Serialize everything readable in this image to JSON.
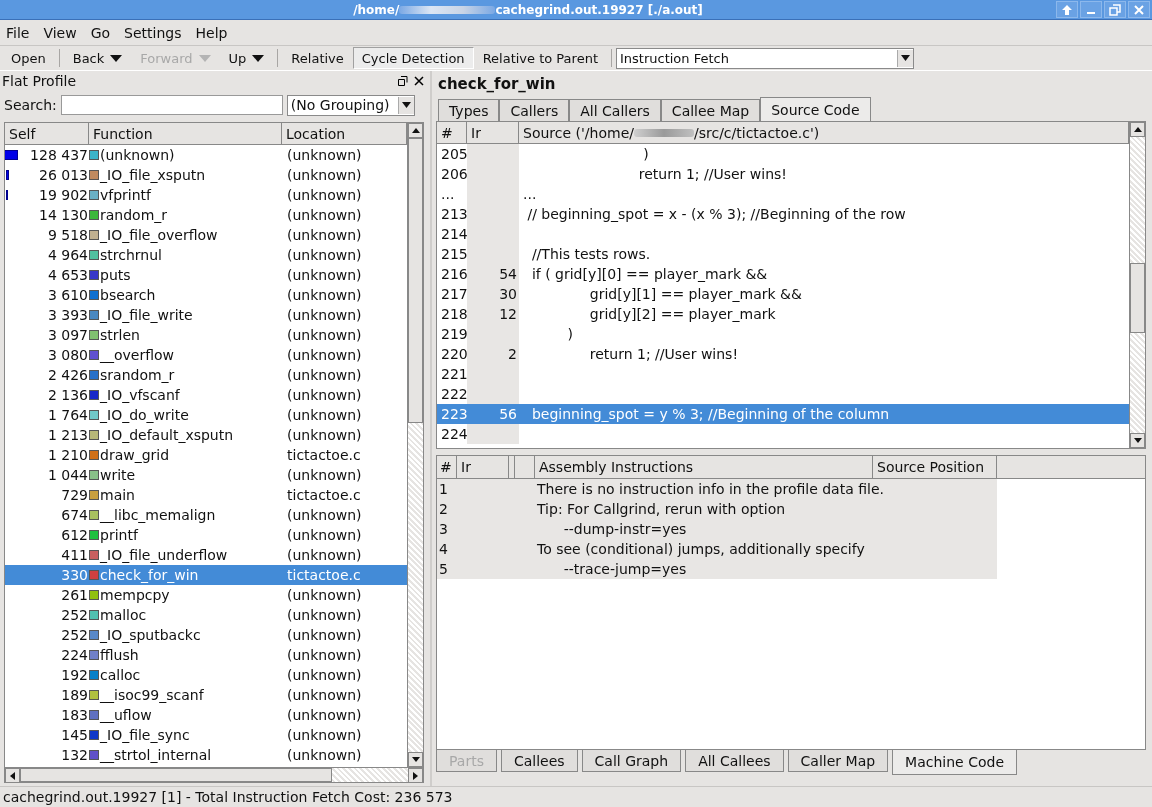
{
  "window": {
    "title_start": "/home/",
    "title_end": "cachegrind.out.19927 [./a.out]"
  },
  "menu": [
    "File",
    "View",
    "Go",
    "Settings",
    "Help"
  ],
  "toolbar": [
    {
      "label": "Open",
      "kind": "button",
      "disabled": false
    },
    {
      "label": "Back",
      "kind": "dropdown",
      "disabled": false
    },
    {
      "label": "Forward",
      "kind": "dropdown",
      "disabled": true
    },
    {
      "label": "Up",
      "kind": "dropdown",
      "disabled": false
    },
    {
      "label": "Relative",
      "kind": "toggle",
      "on": false,
      "disabled": false
    },
    {
      "label": "Cycle Detection",
      "kind": "toggle",
      "on": true,
      "disabled": false
    },
    {
      "label": "Relative to Parent",
      "kind": "toggle",
      "on": false,
      "disabled": false
    }
  ],
  "event_type": {
    "value": "Instruction Fetch"
  },
  "flat_profile": {
    "title": "Flat Profile",
    "search_label": "Search:",
    "grouping": "(No Grouping)",
    "columns": [
      "Self",
      "Function",
      "Location"
    ],
    "rows": [
      {
        "self": "128 437",
        "function": "(unknown)",
        "color": "#3cb4c8",
        "location": "(unknown)",
        "level": 0.543,
        "selected": false
      },
      {
        "self": "26 013",
        "function": "_IO_file_xsputn",
        "color": "#c08a60",
        "location": "(unknown)",
        "level": 0.11,
        "selected": false
      },
      {
        "self": "19 902",
        "function": "vfprintf",
        "color": "#6ab0c4",
        "location": "(unknown)",
        "level": 0.084,
        "selected": false
      },
      {
        "self": "14 130",
        "function": "random_r",
        "color": "#3cb83c",
        "location": "(unknown)",
        "selected": false
      },
      {
        "self": "9 518",
        "function": "_IO_file_overflow",
        "color": "#c0b090",
        "location": "(unknown)",
        "selected": false
      },
      {
        "self": "4 964",
        "function": "strchrnul",
        "color": "#50c0a0",
        "location": "(unknown)",
        "selected": false
      },
      {
        "self": "4 653",
        "function": "puts",
        "color": "#3838c8",
        "location": "(unknown)",
        "selected": false
      },
      {
        "self": "3 610",
        "function": "bsearch",
        "color": "#1070d0",
        "location": "(unknown)",
        "selected": false
      },
      {
        "self": "3 393",
        "function": "_IO_file_write",
        "color": "#4a88c0",
        "location": "(unknown)",
        "selected": false
      },
      {
        "self": "3 097",
        "function": "strlen",
        "color": "#80c070",
        "location": "(unknown)",
        "selected": false
      },
      {
        "self": "3 080",
        "function": "__overflow",
        "color": "#6050d0",
        "location": "(unknown)",
        "selected": false
      },
      {
        "self": "2 426",
        "function": "srandom_r",
        "color": "#2870c8",
        "location": "(unknown)",
        "selected": false
      },
      {
        "self": "2 136",
        "function": "_IO_vfscanf",
        "color": "#1828c8",
        "location": "(unknown)",
        "selected": false
      },
      {
        "self": "1 764",
        "function": "_IO_do_write",
        "color": "#70c8c8",
        "location": "(unknown)",
        "selected": false
      },
      {
        "self": "1 213",
        "function": "_IO_default_xsputn",
        "color": "#b8b878",
        "location": "(unknown)",
        "selected": false
      },
      {
        "self": "1 210",
        "function": "draw_grid",
        "color": "#d07018",
        "location": "tictactoe.c",
        "selected": false
      },
      {
        "self": "1 044",
        "function": "write",
        "color": "#88c088",
        "location": "(unknown)",
        "selected": false
      },
      {
        "self": "729",
        "function": "main",
        "color": "#c8a040",
        "location": "tictactoe.c",
        "selected": false
      },
      {
        "self": "674",
        "function": "__libc_memalign",
        "color": "#a8c060",
        "location": "(unknown)",
        "selected": false
      },
      {
        "self": "612",
        "function": "printf",
        "color": "#20c040",
        "location": "(unknown)",
        "selected": false
      },
      {
        "self": "411",
        "function": "_IO_file_underflow",
        "color": "#c86060",
        "location": "(unknown)",
        "selected": false
      },
      {
        "self": "330",
        "function": "check_for_win",
        "color": "#d04040",
        "location": "tictactoe.c",
        "selected": true
      },
      {
        "self": "261",
        "function": "mempcpy",
        "color": "#90c010",
        "location": "(unknown)",
        "selected": false
      },
      {
        "self": "252",
        "function": "malloc",
        "color": "#50c0b0",
        "location": "(unknown)",
        "selected": false
      },
      {
        "self": "252",
        "function": "_IO_sputbackc",
        "color": "#5888c8",
        "location": "(unknown)",
        "selected": false
      },
      {
        "self": "224",
        "function": "fflush",
        "color": "#7080c8",
        "location": "(unknown)",
        "selected": false
      },
      {
        "self": "192",
        "function": "calloc",
        "color": "#0880c8",
        "location": "(unknown)",
        "selected": false
      },
      {
        "self": "189",
        "function": "__isoc99_scanf",
        "color": "#b0c040",
        "location": "(unknown)",
        "selected": false
      },
      {
        "self": "183",
        "function": "__uflow",
        "color": "#6070c0",
        "location": "(unknown)",
        "selected": false
      },
      {
        "self": "145",
        "function": "_IO_file_sync",
        "color": "#1038c8",
        "location": "(unknown)",
        "selected": false
      },
      {
        "self": "132",
        "function": "__strtol_internal",
        "color": "#6050c8",
        "location": "(unknown)",
        "selected": false
      }
    ]
  },
  "function_title": "check_for_win",
  "top_tabs": [
    {
      "label": "Types",
      "selected": false
    },
    {
      "label": "Callers",
      "selected": false
    },
    {
      "label": "All Callers",
      "selected": false
    },
    {
      "label": "Callee Map",
      "selected": false
    },
    {
      "label": "Source Code",
      "selected": true
    }
  ],
  "source": {
    "columns": [
      "#",
      "Ir"
    ],
    "header_start": "Source ('/home/",
    "header_end": "/src/c/tictactoe.c')",
    "rows": [
      {
        "line": "205",
        "code": "                           )",
        "selected": false
      },
      {
        "line": "206",
        "code": "                          return 1; //User wins!",
        "selected": false
      },
      {
        "line": "...",
        "code": "...",
        "selected": false
      },
      {
        "line": "213",
        "code": " // beginning_spot = x - (x % 3); //Beginning of the row",
        "selected": false
      },
      {
        "line": "214",
        "selected": false
      },
      {
        "line": "215",
        "code": "  //This tests rows.",
        "selected": false
      },
      {
        "line": "216",
        "ir": "54",
        "code": "  if ( grid[y][0] == player_mark &&",
        "selected": false
      },
      {
        "line": "217",
        "ir": "30",
        "code": "               grid[y][1] == player_mark &&",
        "selected": false
      },
      {
        "line": "218",
        "ir": "12",
        "code": "               grid[y][2] == player_mark",
        "selected": false
      },
      {
        "line": "219",
        "code": "          )",
        "selected": false
      },
      {
        "line": "220",
        "ir": "2",
        "code": "               return 1; //User wins!",
        "selected": false
      },
      {
        "line": "221",
        "selected": false
      },
      {
        "line": "222",
        "selected": false
      },
      {
        "line": "223",
        "ir": "56",
        "code": "  beginning_spot = y % 3; //Beginning of the column",
        "selected": true
      },
      {
        "line": "224",
        "selected": false
      }
    ]
  },
  "assembly": {
    "columns": [
      "#",
      "Ir",
      "Assembly Instructions",
      "Source Position"
    ],
    "rows": [
      {
        "line": "1",
        "text": "There is no instruction info in the profile data file."
      },
      {
        "line": "2",
        "text": "Tip: For Callgrind, rerun with option"
      },
      {
        "line": "3",
        "text": "      --dump-instr=yes"
      },
      {
        "line": "4",
        "text": "To see (conditional) jumps, additionally specify"
      },
      {
        "line": "5",
        "text": "      --trace-jump=yes"
      }
    ]
  },
  "bottom_tabs": [
    {
      "label": "Parts",
      "selected": false,
      "disabled": true
    },
    {
      "label": "Callees",
      "selected": false,
      "disabled": false
    },
    {
      "label": "Call Graph",
      "selected": false,
      "disabled": false
    },
    {
      "label": "All Callees",
      "selected": false,
      "disabled": false
    },
    {
      "label": "Caller Map",
      "selected": false,
      "disabled": false
    },
    {
      "label": "Machine Code",
      "selected": true,
      "disabled": false
    }
  ],
  "status_bar": "cachegrind.out.19927 [1] - Total Instruction Fetch Cost: 236 573"
}
